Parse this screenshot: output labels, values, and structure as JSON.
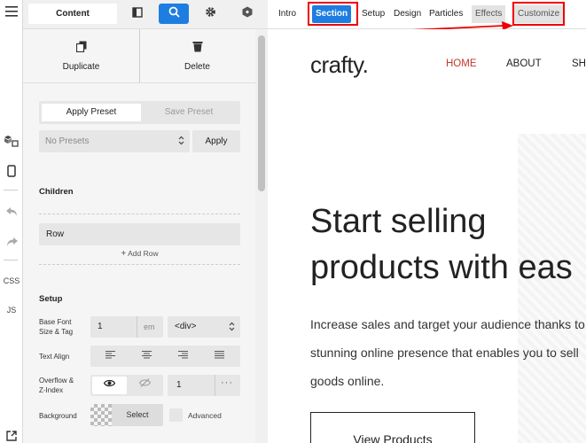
{
  "rail": {
    "css_label": "CSS",
    "js_label": "JS"
  },
  "toolbar": {
    "content_label": "Content"
  },
  "actions": {
    "duplicate_label": "Duplicate",
    "delete_label": "Delete"
  },
  "presets": {
    "apply_tab": "Apply Preset",
    "save_tab": "Save Preset",
    "select_value": "No Presets",
    "apply_button": "Apply"
  },
  "children": {
    "title": "Children",
    "row_label": "Row",
    "add_row_label": "Add Row"
  },
  "setup": {
    "title": "Setup",
    "font_label_line1": "Base Font",
    "font_label_line2": "Size & Tag",
    "font_size_value": "1",
    "font_unit": "em",
    "tag_value": "<div>",
    "text_align_label": "Text Align",
    "overflow_label_line1": "Overflow &",
    "overflow_label_line2": "Z-Index",
    "zindex_value": "1",
    "background_label": "Background",
    "select_button": "Select",
    "advanced_label": "Advanced"
  },
  "nav": {
    "items": [
      {
        "label": "Intro"
      },
      {
        "label": "Section"
      },
      {
        "label": "Setup"
      },
      {
        "label": "Design"
      },
      {
        "label": "Particles"
      },
      {
        "label": "Effects"
      },
      {
        "label": "Customize"
      }
    ]
  },
  "site": {
    "logo": "crafty.",
    "menu": [
      "HOME",
      "ABOUT",
      "SH"
    ],
    "headline_line1": "Start selling",
    "headline_line2": "products with eas",
    "body_line1": "Increase sales and target your audience thanks to",
    "body_line2": "stunning online presence that enables you to sell",
    "body_line3": "goods online.",
    "cta": "View Products"
  },
  "colors": {
    "accent": "#1e7de0",
    "annotation_red": "#e00000",
    "home_link": "#c0392b"
  }
}
